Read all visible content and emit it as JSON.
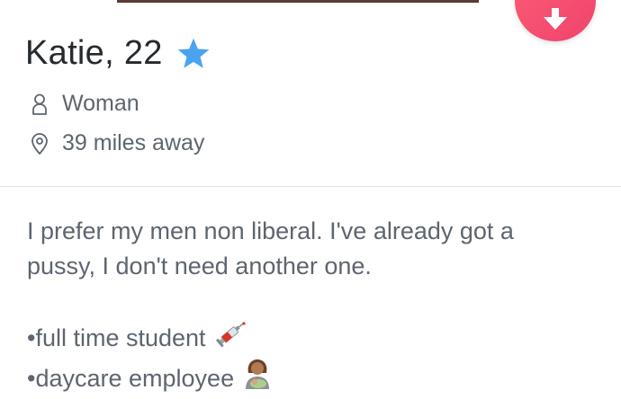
{
  "profile": {
    "name_age": "Katie, 22",
    "gender": "Woman",
    "distance": "39 miles away",
    "bio_line1": "I prefer my men non liberal. I've already got a",
    "bio_line2": "pussy, I don't need another one.",
    "bullets": [
      {
        "text": "•full time student",
        "emoji": "syringe-icon"
      },
      {
        "text": "•daycare employee",
        "emoji": "woman-with-baby-icon"
      }
    ]
  },
  "colors": {
    "accent": "#f0436d",
    "star": "#4aa3ee",
    "text_primary": "#262a2f",
    "text_secondary": "#5e6570"
  },
  "icons": {
    "action": "arrow-down-icon",
    "verified": "star-icon",
    "gender": "person-icon",
    "distance": "location-pin-icon"
  }
}
